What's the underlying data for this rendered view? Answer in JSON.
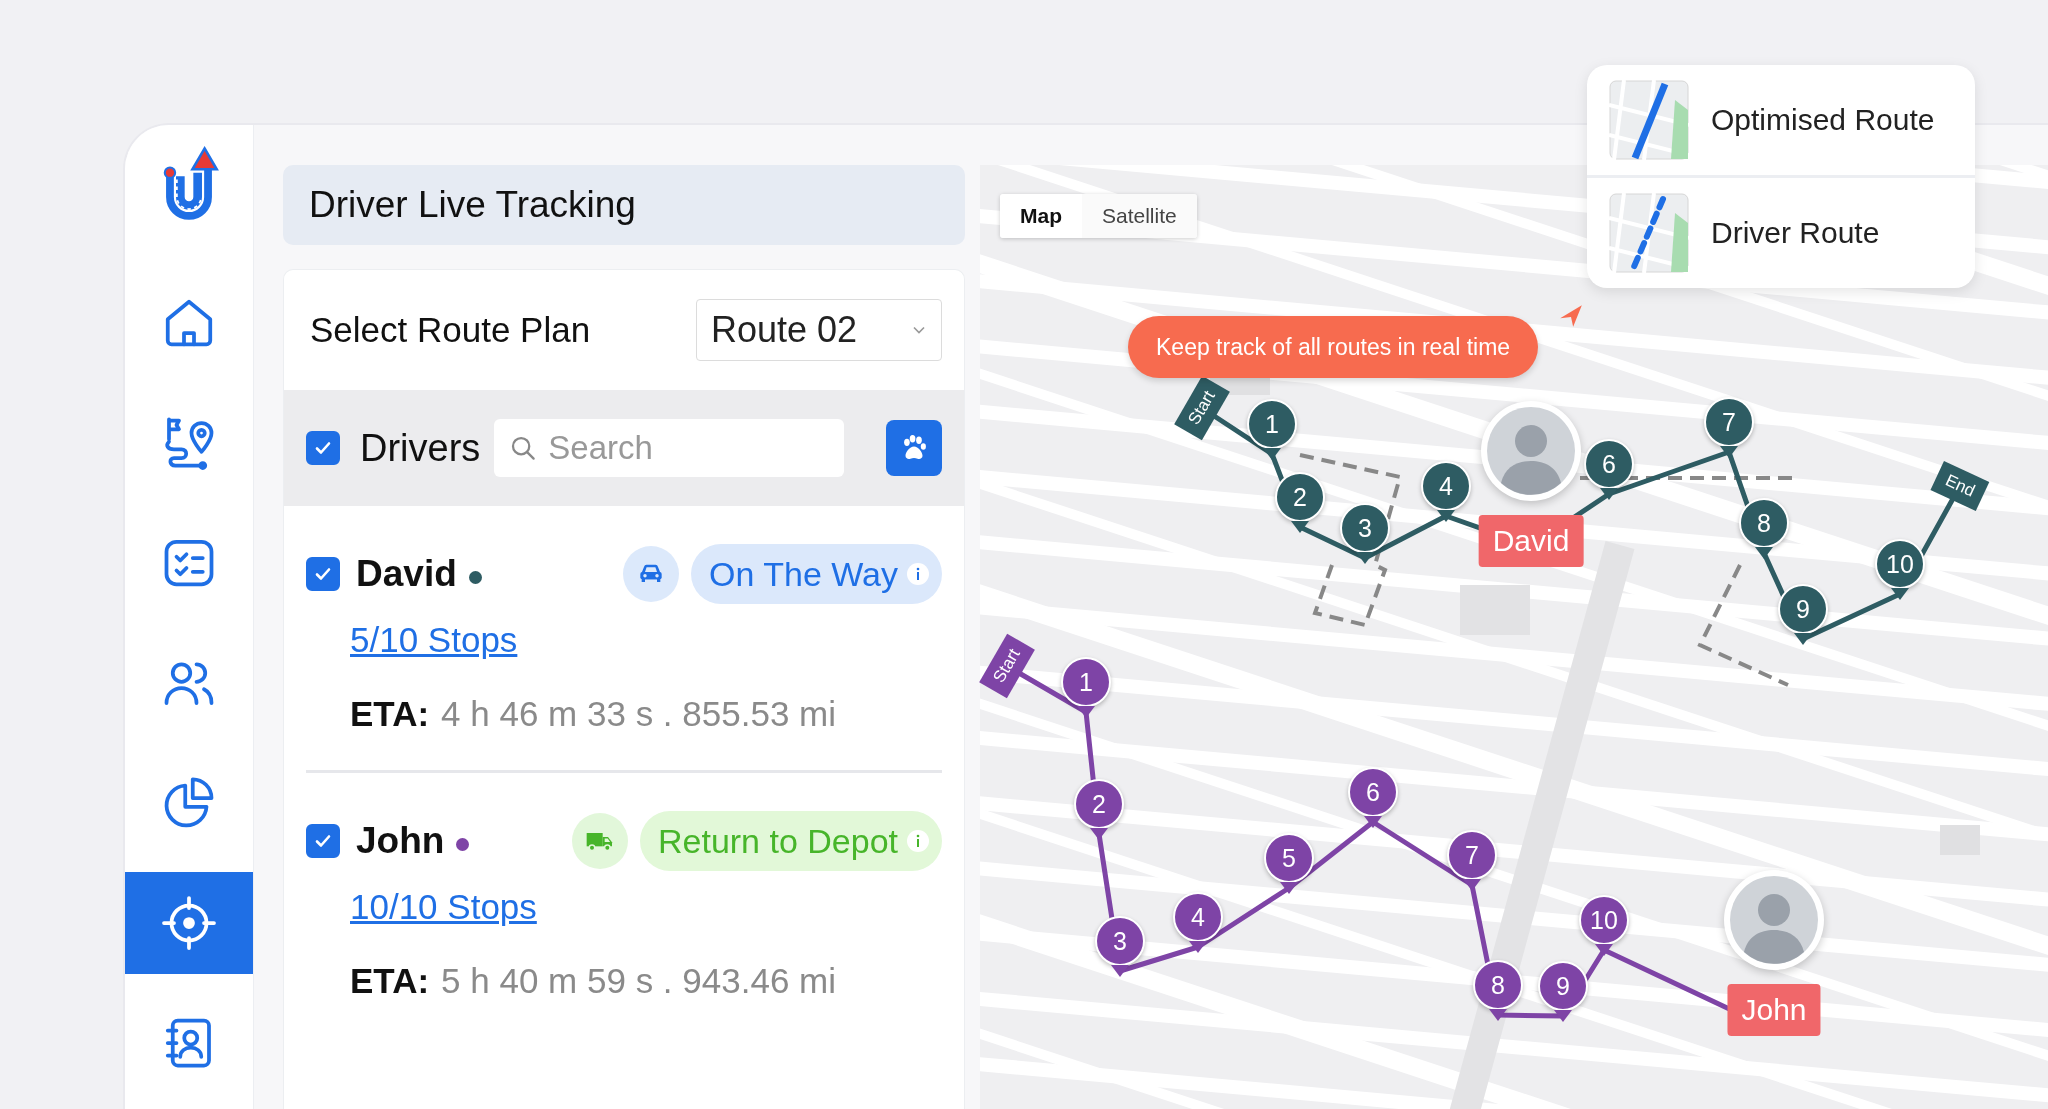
{
  "sidebar": {
    "items": [
      {
        "kind": "home",
        "selected": false
      },
      {
        "kind": "routes",
        "selected": false
      },
      {
        "kind": "tasks",
        "selected": false
      },
      {
        "kind": "team",
        "selected": false
      },
      {
        "kind": "reports",
        "selected": false
      },
      {
        "kind": "tracking",
        "selected": true
      },
      {
        "kind": "contacts",
        "selected": false
      }
    ]
  },
  "panel": {
    "title": "Driver Live Tracking",
    "route_plan": {
      "label": "Select Route Plan",
      "value": "Route 02"
    },
    "drivers_header": {
      "label": "Drivers",
      "checked": true,
      "search": {
        "placeholder": "Search"
      }
    },
    "drivers": [
      {
        "name": "David",
        "color": "#2e5c63",
        "checked": true,
        "vehicle": {
          "kind": "car"
        },
        "status": {
          "label": "On The Way",
          "kind": "transit"
        },
        "stops": "5/10 Stops",
        "eta_label": "ETA:",
        "eta": "4 h 46 m 33 s . 855.53 mi"
      },
      {
        "name": "John",
        "color": "#7e44a6",
        "checked": true,
        "vehicle": {
          "kind": "truck"
        },
        "status": {
          "label": "Return to Depot",
          "kind": "depot"
        },
        "stops": "10/10 Stops",
        "eta_label": "ETA:",
        "eta": "5 h 40 m 59 s . 943.46 mi"
      }
    ]
  },
  "map": {
    "view_toggle": [
      {
        "label": "Map",
        "selected": true
      },
      {
        "label": "Satellite",
        "selected": false
      }
    ],
    "legend": [
      {
        "label": "Optimised Route",
        "kind": "solid"
      },
      {
        "label": "Driver Route",
        "kind": "dashed"
      }
    ],
    "tooltip": "Keep track of all routes in real time",
    "routes": [
      {
        "color": "#2e5c63",
        "start_label": "Start",
        "end_label": "End",
        "stops": [
          "1",
          "2",
          "3",
          "4",
          "6",
          "7",
          "8",
          "9",
          "10"
        ],
        "driver_label": "David"
      },
      {
        "color": "#7e44a6",
        "start_label": "Start",
        "stops": [
          "1",
          "2",
          "3",
          "4",
          "5",
          "6",
          "7",
          "8",
          "9",
          "10"
        ],
        "driver_label": "John"
      }
    ]
  }
}
